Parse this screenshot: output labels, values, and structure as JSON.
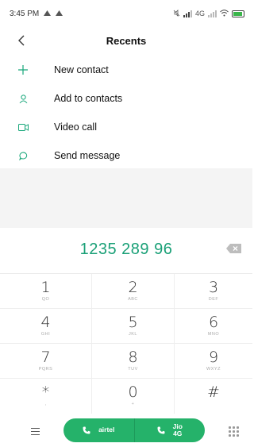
{
  "status_bar": {
    "time": "3:45 PM",
    "network": "4G"
  },
  "header": {
    "title": "Recents"
  },
  "actions": [
    {
      "icon": "plus-icon",
      "label": "New contact"
    },
    {
      "icon": "person-icon",
      "label": "Add to contacts"
    },
    {
      "icon": "video-icon",
      "label": "Video call"
    },
    {
      "icon": "chat-bubble-icon",
      "label": "Send message"
    }
  ],
  "dialer": {
    "number": "1235 289 96"
  },
  "keypad": [
    {
      "digit": "1",
      "letters": "QO"
    },
    {
      "digit": "2",
      "letters": "ABC"
    },
    {
      "digit": "3",
      "letters": "DEF"
    },
    {
      "digit": "4",
      "letters": "GHI"
    },
    {
      "digit": "5",
      "letters": "JKL"
    },
    {
      "digit": "6",
      "letters": "MNO"
    },
    {
      "digit": "7",
      "letters": "PQRS"
    },
    {
      "digit": "8",
      "letters": "TUV"
    },
    {
      "digit": "9",
      "letters": "WXYZ"
    },
    {
      "digit": "*",
      "letters": ","
    },
    {
      "digit": "0",
      "letters": "+"
    },
    {
      "digit": "#",
      "letters": ""
    }
  ],
  "call_buttons": {
    "sim1_label": "airtel",
    "sim2_label_line1": "Jio",
    "sim2_label_line2": "4G"
  },
  "colors": {
    "accent": "#1aa077",
    "call_button": "#25b26a"
  }
}
